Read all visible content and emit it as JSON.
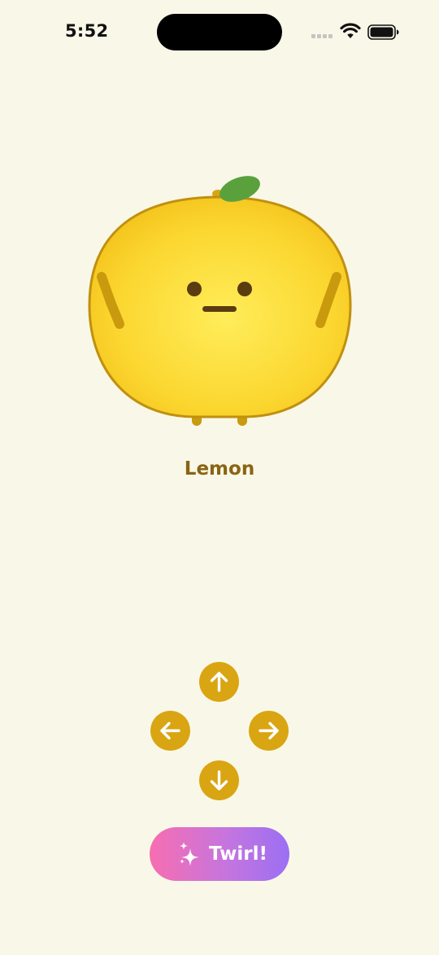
{
  "status_bar": {
    "time": "5:52",
    "icons": [
      "signal-icon",
      "wifi-icon",
      "battery-icon"
    ]
  },
  "character": {
    "name": "Lemon",
    "colors": {
      "body_light": "#ffeb57",
      "body_dark": "#f6c51d",
      "outline": "#c0900f",
      "limbs": "#c99a0e",
      "leaf": "#5aa13e",
      "face": "#5a3c10"
    }
  },
  "controls": {
    "dpad": [
      {
        "direction": "up",
        "icon": "arrow-up-icon"
      },
      {
        "direction": "left",
        "icon": "arrow-left-icon"
      },
      {
        "direction": "right",
        "icon": "arrow-right-icon"
      },
      {
        "direction": "down",
        "icon": "arrow-down-icon"
      }
    ],
    "dpad_color": "#d9a512",
    "twirl_label": "Twirl!",
    "twirl_icon": "sparkles-icon",
    "twirl_gradient": [
      "#f76eb0",
      "#9b6ff3"
    ]
  }
}
